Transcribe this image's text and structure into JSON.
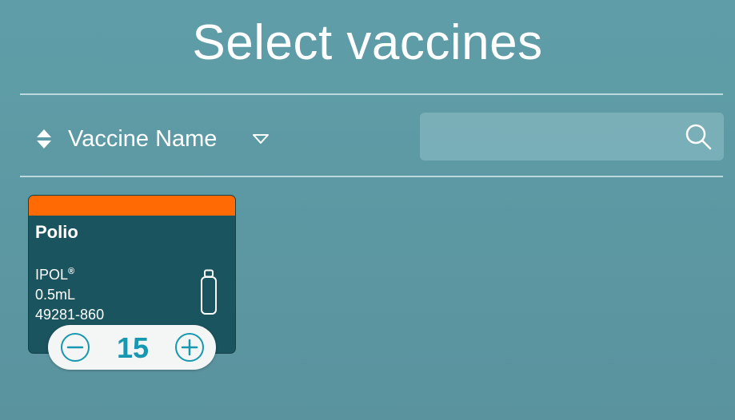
{
  "header": {
    "title": "Select vaccines"
  },
  "sort": {
    "label": "Vaccine Name"
  },
  "search": {
    "value": "",
    "placeholder": ""
  },
  "colors": {
    "background": "#5c9aa4",
    "card_background": "#1a545e",
    "card_stripe": "#ff6a04",
    "stepper_accent": "#1797b0"
  },
  "vaccines": [
    {
      "name": "Polio",
      "brand": "IPOL",
      "brand_mark": "®",
      "dose": "0.5mL",
      "ndc": "49281-860",
      "quantity": "15"
    }
  ]
}
